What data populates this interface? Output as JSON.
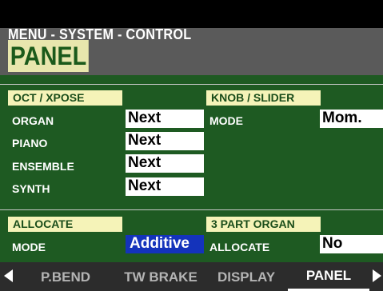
{
  "menu_path": "MENU - SYSTEM - CONTROL",
  "page_title": "PANEL",
  "oct_xpose": {
    "heading": "OCT / XPOSE",
    "rows": [
      {
        "label": "ORGAN",
        "value": "Next"
      },
      {
        "label": "PIANO",
        "value": "Next"
      },
      {
        "label": "ENSEMBLE",
        "value": "Next"
      },
      {
        "label": "SYNTH",
        "value": "Next"
      }
    ]
  },
  "knob_slider": {
    "heading": "KNOB / SLIDER",
    "mode_label": "MODE",
    "mode_value": "Mom."
  },
  "allocate": {
    "heading": "ALLOCATE",
    "mode_label": "MODE",
    "mode_value": "Additive"
  },
  "three_part_organ": {
    "heading": "3 PART ORGAN",
    "allocate_label": "ALLOCATE",
    "allocate_value": "No"
  },
  "tabs": [
    "P.BEND",
    "TW BRAKE",
    "DISPLAY",
    "PANEL"
  ],
  "active_tab": "PANEL",
  "icons": {
    "prev": "triangle-left-icon",
    "next": "triangle-right-icon"
  },
  "colors": {
    "panel_bg": "#1e5a22",
    "section_bg": "#f5f3b8",
    "selected_bg": "#1433bb"
  }
}
